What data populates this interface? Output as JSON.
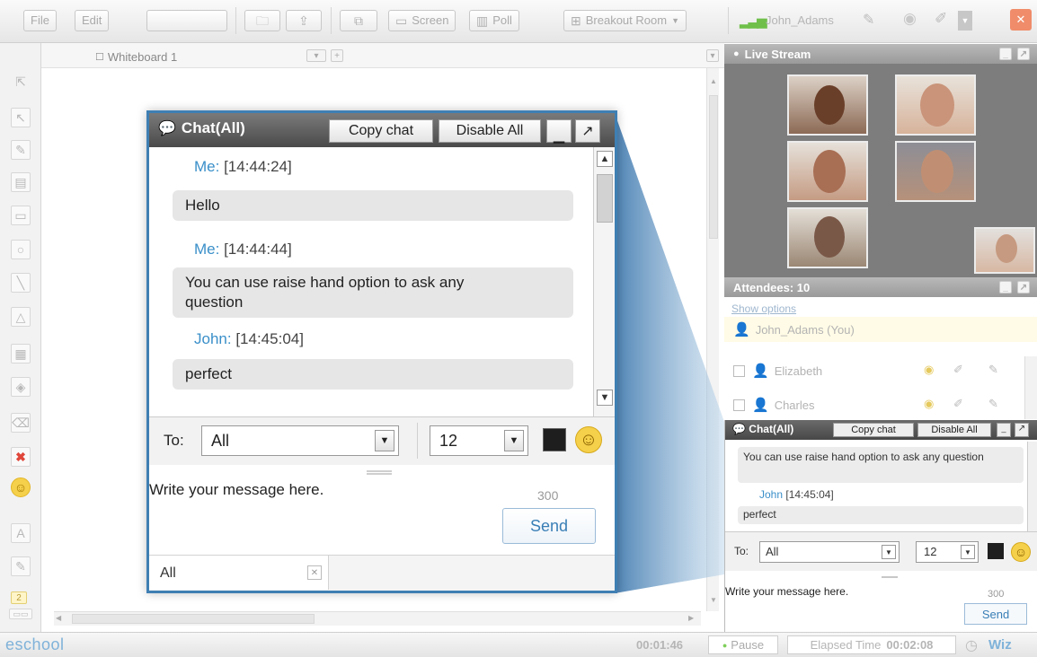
{
  "toolbar": {
    "file": "File",
    "edit": "Edit",
    "screen": "Screen",
    "poll": "Poll",
    "breakout": "Breakout Room",
    "user": "John_Adams",
    "close": "✕"
  },
  "whiteboard": {
    "tab_label": "Whiteboard 1",
    "add_tab": "+"
  },
  "chat": {
    "title": "Chat(All)",
    "copy_chat": "Copy chat",
    "disable_all": "Disable All",
    "messages": [
      {
        "sender": "Me:",
        "time": "[14:44:24]",
        "text": "Hello"
      },
      {
        "sender": "Me:",
        "time": "[14:44:44]",
        "text": "You can use raise hand option to ask any question"
      },
      {
        "sender": "John:",
        "time": "[14:45:04]",
        "text": "perfect"
      }
    ],
    "to_label": "To:",
    "to_value": "All",
    "font_size": "12",
    "message_placeholder": "Write your message here.",
    "char_count": "300",
    "send": "Send",
    "tab_all": "All",
    "tab_close": "✕"
  },
  "live_stream": {
    "title": "Live Stream"
  },
  "attendees": {
    "title": "Attendees: 10",
    "show_options": "Show options",
    "list": [
      {
        "name": "John_Adams (You)"
      },
      {
        "name": "Elizabeth"
      },
      {
        "name": "Charles"
      }
    ]
  },
  "small_chat": {
    "title": "Chat(All)",
    "copy_chat": "Copy chat",
    "disable_all": "Disable All",
    "message1": "You can use raise hand option to ask any question",
    "sender": "John",
    "time": "[14:45:04]",
    "message2": "perfect",
    "to_label": "To:",
    "to_value": "All",
    "font_size": "12",
    "placeholder": "Write your message here.",
    "char_count": "300",
    "send": "Send"
  },
  "status": {
    "logo": "eschool",
    "timer": "00:01:46",
    "pause": "Pause",
    "elapsed_label": "Elapsed Time",
    "elapsed_value": "00:02:08",
    "brand": "Wiz"
  },
  "colors": {
    "accent_blue": "#3f7fb3",
    "sender_blue": "#3a8fc9",
    "header_dark": "#4a4a4a",
    "close_orange": "#f08c6a",
    "bubble_gray": "#e6e6e6"
  }
}
